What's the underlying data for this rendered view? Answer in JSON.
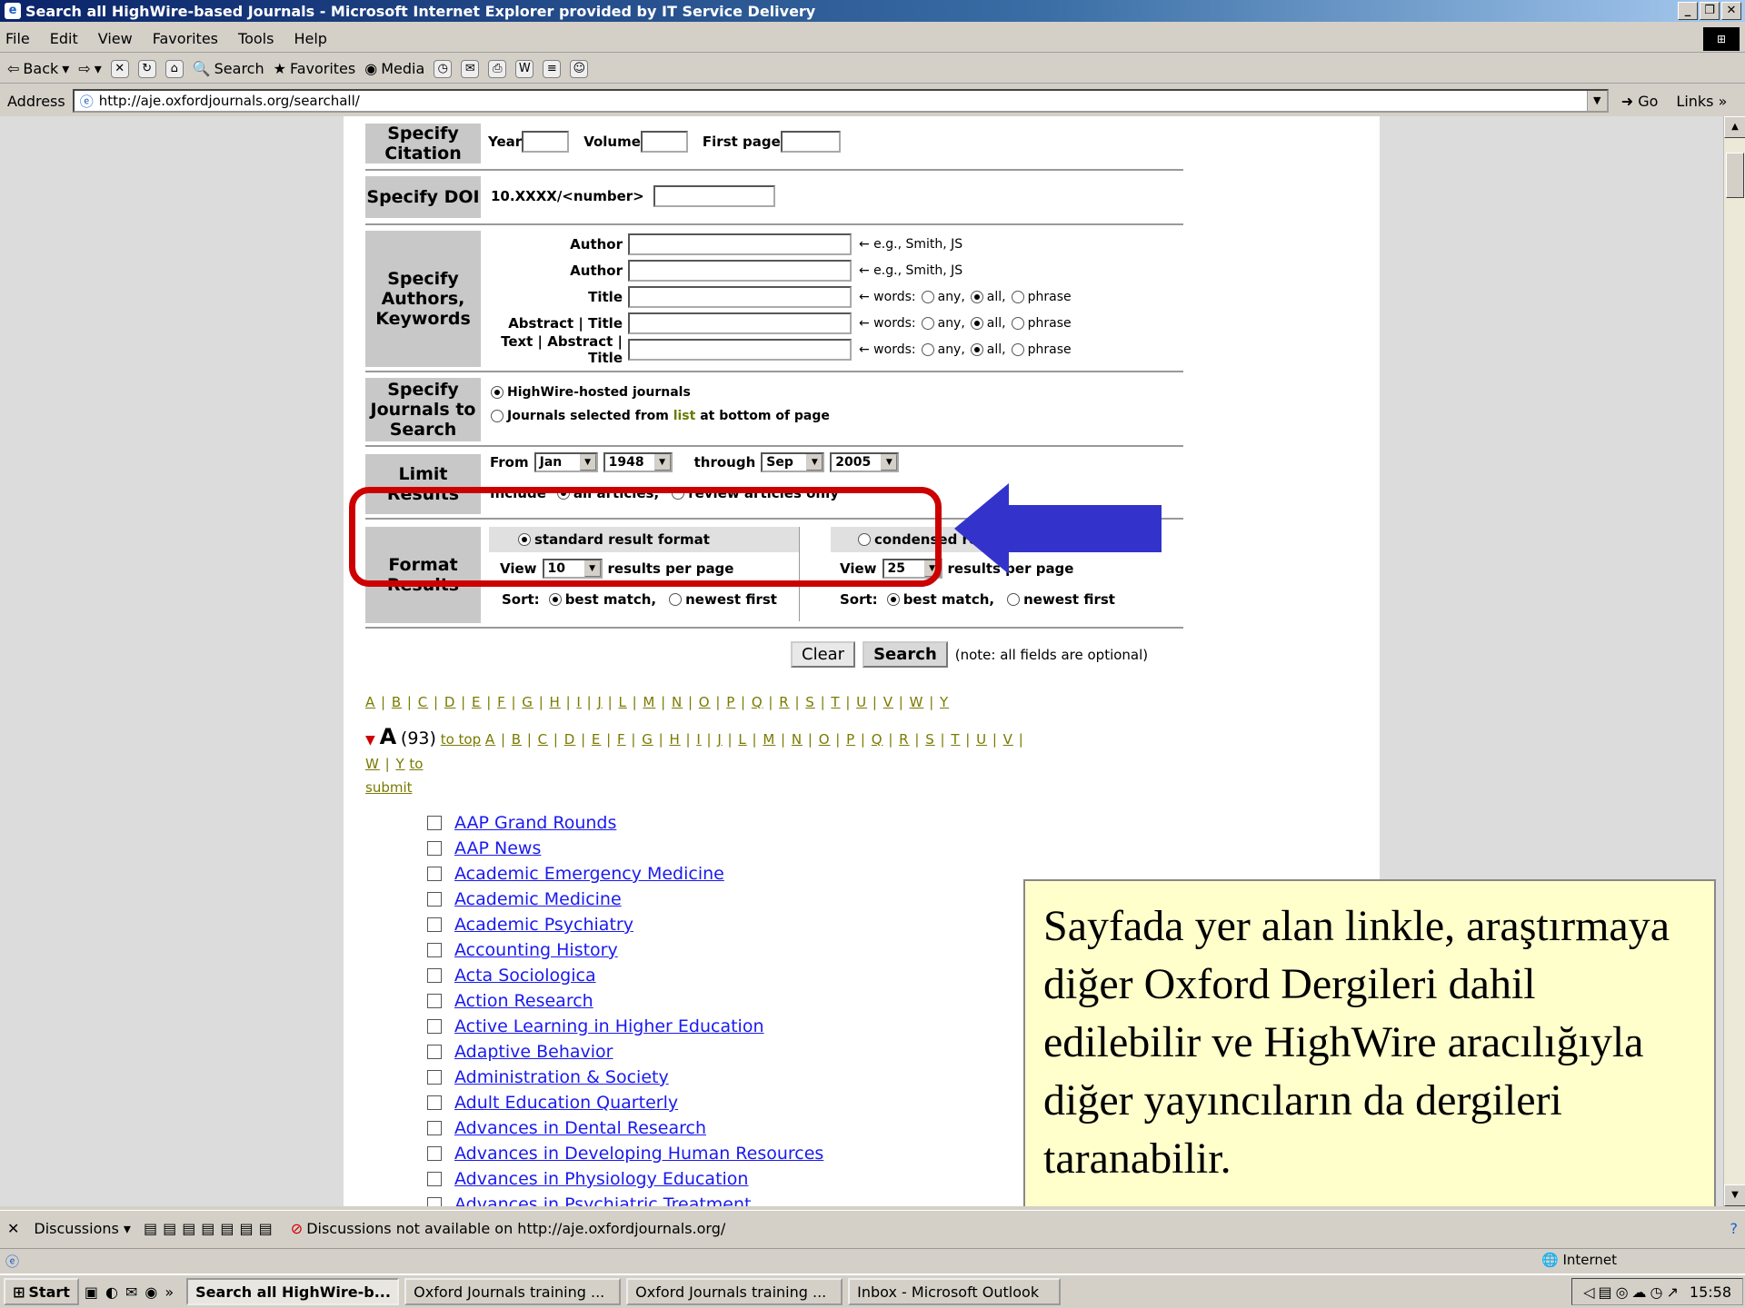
{
  "window": {
    "title": "Search all HighWire-based Journals - Microsoft Internet Explorer provided by IT Service Delivery"
  },
  "menu": [
    "File",
    "Edit",
    "View",
    "Favorites",
    "Tools",
    "Help"
  ],
  "toolbar": {
    "back": "Back",
    "search": "Search",
    "favorites": "Favorites",
    "media": "Media"
  },
  "address": {
    "label": "Address",
    "url": "http://aje.oxfordjournals.org/searchall/",
    "go": "Go",
    "links": "Links"
  },
  "form": {
    "citation": {
      "label": "Specify Citation",
      "year": "Year",
      "volume": "Volume",
      "first_page": "First page"
    },
    "doi": {
      "label": "Specify DOI",
      "prefix": "10.XXXX/<number>"
    },
    "authors": {
      "label": "Specify Authors, Keywords",
      "rows": [
        {
          "label": "Author",
          "hint": "← e.g., Smith, JS"
        },
        {
          "label": "Author",
          "hint": "← e.g., Smith, JS"
        },
        {
          "label": "Title",
          "hint": "← words:"
        },
        {
          "label": "Abstract | Title",
          "hint": "← words:"
        },
        {
          "label": "Text | Abstract | Title",
          "hint": "← words:"
        }
      ],
      "opt_any": "any,",
      "opt_all": "all,",
      "opt_phrase": "phrase"
    },
    "journals": {
      "label": "Specify Journals to Search",
      "opt1": "HighWire-hosted journals",
      "opt2_pre": "Journals selected from",
      "opt2_link": "list",
      "opt2_post": "at bottom of page"
    },
    "limit": {
      "label": "Limit Results",
      "from": "From",
      "from_month": "Jan",
      "from_year": "1948",
      "through": "through",
      "to_month": "Sep",
      "to_year": "2005",
      "include": "Include",
      "all_articles": "all articles,",
      "review_only": "review articles only"
    },
    "format": {
      "label": "Format Results",
      "standard": "standard result format",
      "condensed": "condensed result format",
      "view": "View",
      "std_count": "10",
      "cond_count": "25",
      "per_page": "results per page",
      "sort": "Sort:",
      "best": "best match,",
      "newest": "newest first"
    },
    "clear": "Clear",
    "search": "Search",
    "note": "(note: all fields are optional)"
  },
  "alphabet": [
    "A",
    "B",
    "C",
    "D",
    "E",
    "F",
    "G",
    "H",
    "I",
    "J",
    "L",
    "M",
    "N",
    "O",
    "P",
    "Q",
    "R",
    "S",
    "T",
    "U",
    "V",
    "W",
    "Y"
  ],
  "section": {
    "letter": "A",
    "count": "(93)",
    "to_top": "to top",
    "to_submit_a": "to",
    "to_submit_b": "submit"
  },
  "journals": [
    "AAP Grand Rounds",
    "AAP News",
    "Academic Emergency Medicine",
    "Academic Medicine",
    "Academic Psychiatry",
    "Accounting History",
    "Acta Sociologica",
    "Action Research",
    "Active Learning in Higher Education",
    "Adaptive Behavior",
    "Administration & Society",
    "Adult Education Quarterly",
    "Advances in Dental Research",
    "Advances in Developing Human Resources",
    "Advances in Physiology Education",
    "Advances in Psychiatric Treatment"
  ],
  "annotation": {
    "text": "Sayfada yer alan linkle, araştırmaya  diğer  Oxford Dergileri  dahil edilebilir ve HighWire aracılığıyla diğer yayıncıların da dergileri taranabilir."
  },
  "colors": {
    "highlight_ring": "#cc0000",
    "arrow": "#3333cc",
    "note_bg": "#ffffcc"
  },
  "discussions": {
    "label": "Discussions",
    "status": "Discussions not available on http://aje.oxfordjournals.org/"
  },
  "status": {
    "zone": "Internet"
  },
  "taskbar": {
    "start": "Start",
    "tasks": [
      "Search all HighWire-b...",
      "Oxford Journals training ...",
      "Oxford Journals training ...",
      "Inbox - Microsoft Outlook"
    ],
    "clock": "15:58"
  }
}
